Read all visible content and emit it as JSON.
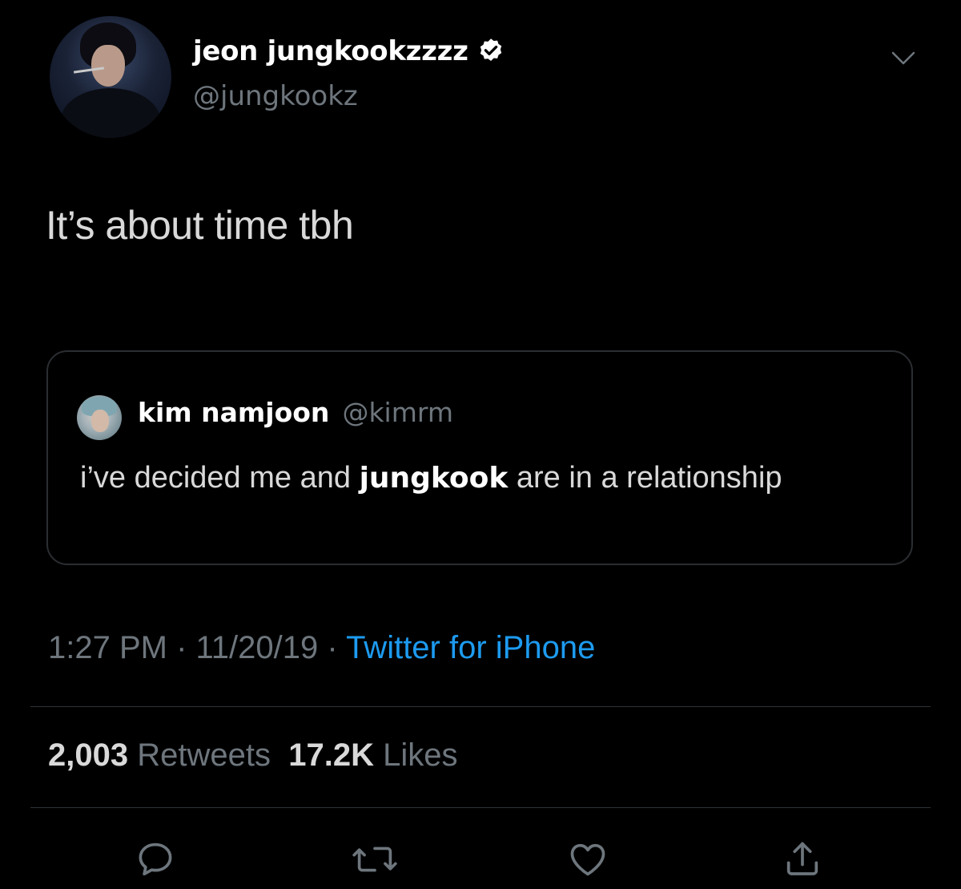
{
  "author": {
    "display_name": "jeon jungkookzzzz",
    "handle": "@jungkookz",
    "verified": true,
    "avatar_icon": "profile-photo"
  },
  "tweet": {
    "text": "It’s about time tbh"
  },
  "quoted_tweet": {
    "display_name": "kim namjoon",
    "handle": "@kimrm",
    "text_before": "i’ve decided me and ",
    "text_highlight": "jungkook",
    "text_after": " are in a relationship"
  },
  "meta": {
    "time": "1:27 PM",
    "separator": " · ",
    "date": "11/20/19",
    "source": "Twitter for iPhone"
  },
  "stats": {
    "retweets_count": "2,003",
    "retweets_label": "Retweets",
    "likes_count": "17.2K",
    "likes_label": "Likes"
  },
  "colors": {
    "background": "#000000",
    "text": "#d9d9d9",
    "secondary": "#6e767d",
    "accent": "#1d9bf0",
    "border": "#2f3336"
  },
  "actions": [
    "reply-icon",
    "retweet-icon",
    "like-icon",
    "share-icon"
  ]
}
